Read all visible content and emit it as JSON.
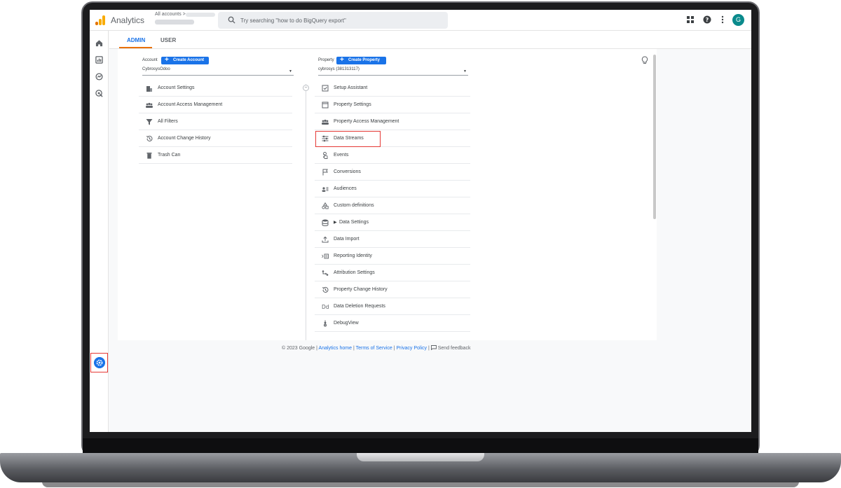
{
  "app": {
    "title": "Analytics",
    "account_crumb": "All accounts >"
  },
  "search": {
    "placeholder": "Try searching \"how to do BigQuery export\""
  },
  "topbar": {
    "avatar_letter": "G"
  },
  "tabs": [
    {
      "label": "ADMIN",
      "active": true
    },
    {
      "label": "USER",
      "active": false
    }
  ],
  "account": {
    "label": "Account",
    "create_label": "Create Account",
    "selected": "CybrosysOdoo",
    "items": [
      {
        "label": "Account Settings",
        "icon": "building-icon"
      },
      {
        "label": "Account Access Management",
        "icon": "people-icon"
      },
      {
        "label": "All Filters",
        "icon": "filter-icon"
      },
      {
        "label": "Account Change History",
        "icon": "history-icon"
      },
      {
        "label": "Trash Can",
        "icon": "trash-icon"
      }
    ]
  },
  "property": {
    "label": "Property",
    "create_label": "Create Property",
    "selected": "cybrosys (381313117)",
    "items": [
      {
        "label": "Setup Assistant",
        "icon": "checkbox-icon"
      },
      {
        "label": "Property Settings",
        "icon": "window-icon"
      },
      {
        "label": "Property Access Management",
        "icon": "people-icon"
      },
      {
        "label": "Data Streams",
        "icon": "streams-icon",
        "highlighted": true
      },
      {
        "label": "Events",
        "icon": "touch-icon"
      },
      {
        "label": "Conversions",
        "icon": "flag-icon"
      },
      {
        "label": "Audiences",
        "icon": "audience-icon"
      },
      {
        "label": "Custom definitions",
        "icon": "shapes-icon"
      },
      {
        "label": "Data Settings",
        "icon": "database-icon",
        "expandable": true
      },
      {
        "label": "Data Import",
        "icon": "upload-icon"
      },
      {
        "label": "Reporting Identity",
        "icon": "identity-icon"
      },
      {
        "label": "Attribution Settings",
        "icon": "attribution-icon"
      },
      {
        "label": "Property Change History",
        "icon": "history-icon"
      },
      {
        "label": "Data Deletion Requests",
        "icon": "dd-icon"
      },
      {
        "label": "DebugView",
        "icon": "debug-icon"
      }
    ]
  },
  "footer": {
    "copyright": "© 2023 Google |",
    "analytics_home": "Analytics home",
    "sep1": "|",
    "terms": "Terms of Service",
    "sep2": "|",
    "privacy": "Privacy Policy",
    "sep3": "|",
    "feedback": "Send feedback"
  },
  "colors": {
    "accent": "#1a73e8",
    "highlight": "#e53935",
    "tab_underline": "#e8710a"
  }
}
